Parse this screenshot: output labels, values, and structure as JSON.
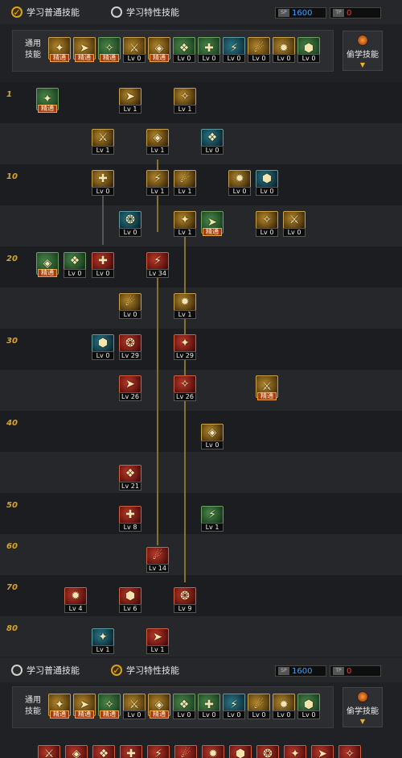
{
  "header": {
    "tab_normal": "学习普通技能",
    "tab_special": "学习特性技能",
    "sp_value": "1600",
    "tp_value": "0",
    "sp_icon": "SP",
    "tp_icon": "TP",
    "common_label_line1": "通用",
    "common_label_line2": "技能",
    "steal_label": "偷学技能"
  },
  "labels": {
    "mastered": "精通",
    "lv0": "Lv 0"
  },
  "levels": [
    "1",
    "10",
    "20",
    "30",
    "40",
    "50",
    "60",
    "70",
    "80"
  ],
  "common_skills": [
    {
      "state": "精通"
    },
    {
      "state": "精通"
    },
    {
      "state": "精通"
    },
    {
      "state": "Lv 0"
    },
    {
      "state": "精通"
    },
    {
      "state": "Lv 0"
    },
    {
      "state": "Lv 0"
    },
    {
      "state": "Lv 0"
    },
    {
      "state": "Lv 0"
    },
    {
      "state": "Lv 0"
    },
    {
      "state": "Lv 0"
    }
  ],
  "tree_skills": [
    {
      "id": "s1",
      "state": "精通"
    },
    {
      "id": "s2",
      "state": "Lv 1"
    },
    {
      "id": "s3",
      "state": "Lv 1"
    },
    {
      "id": "s4",
      "state": "Lv 1"
    },
    {
      "id": "s5",
      "state": "Lv 1"
    },
    {
      "id": "s6",
      "state": "Lv 0"
    },
    {
      "id": "s7",
      "state": "Lv 0"
    },
    {
      "id": "s8",
      "state": "Lv 1"
    },
    {
      "id": "s9",
      "state": "Lv 1"
    },
    {
      "id": "s10",
      "state": "Lv 0"
    },
    {
      "id": "s11",
      "state": "Lv 0"
    },
    {
      "id": "s12",
      "state": "Lv 0"
    },
    {
      "id": "s13",
      "state": "Lv 1"
    },
    {
      "id": "s14",
      "state": "精通"
    },
    {
      "id": "s15",
      "state": "Lv 0"
    },
    {
      "id": "s16",
      "state": "Lv 0"
    },
    {
      "id": "s17",
      "state": "精通"
    },
    {
      "id": "s18",
      "state": "Lv 0"
    },
    {
      "id": "s19",
      "state": "Lv 0"
    },
    {
      "id": "s20",
      "state": "Lv 34"
    },
    {
      "id": "s21",
      "state": "Lv 0"
    },
    {
      "id": "s22",
      "state": "Lv 1"
    },
    {
      "id": "s23",
      "state": "Lv 0"
    },
    {
      "id": "s24",
      "state": "Lv 29"
    },
    {
      "id": "s25",
      "state": "Lv 29"
    },
    {
      "id": "s26",
      "state": "Lv 26"
    },
    {
      "id": "s27",
      "state": "Lv 26"
    },
    {
      "id": "s28",
      "state": "精通"
    },
    {
      "id": "s29",
      "state": "Lv 0"
    },
    {
      "id": "s30",
      "state": "Lv 21"
    },
    {
      "id": "s31",
      "state": "Lv 8"
    },
    {
      "id": "s32",
      "state": "Lv 1"
    },
    {
      "id": "s33",
      "state": "Lv 14"
    },
    {
      "id": "s34",
      "state": "Lv 4"
    },
    {
      "id": "s35",
      "state": "Lv 6"
    },
    {
      "id": "s36",
      "state": "Lv 9"
    },
    {
      "id": "s37",
      "state": "Lv 1"
    },
    {
      "id": "s38",
      "state": "Lv 1"
    }
  ],
  "colors": {
    "accent_gold": "#d8a42a",
    "sp_blue": "#3ea0ff",
    "tp_red": "#e04040",
    "mastered_bg": "#a53c12"
  }
}
